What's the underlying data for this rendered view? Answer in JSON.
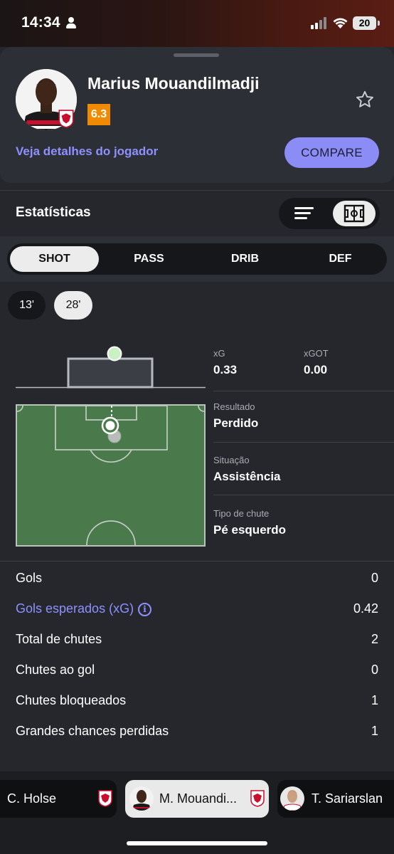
{
  "status_bar": {
    "time": "14:34",
    "battery": "20"
  },
  "player": {
    "name": "Marius Mouandilmadji",
    "rating": "6.3",
    "rating_color": "#f08a00"
  },
  "actions": {
    "details_link": "Veja detalhes do jogador",
    "compare_label": "COMPARE"
  },
  "stats_section": {
    "title": "Estatísticas"
  },
  "tabs": [
    {
      "label": "SHOT",
      "active": true
    },
    {
      "label": "PASS",
      "active": false
    },
    {
      "label": "DRIB",
      "active": false
    },
    {
      "label": "DEF",
      "active": false
    }
  ],
  "shot_chips": [
    {
      "label": "13'",
      "selected": false
    },
    {
      "label": "28'",
      "selected": true
    }
  ],
  "shot_detail": {
    "xg_label": "xG",
    "xg_value": "0.33",
    "xgot_label": "xGOT",
    "xgot_value": "0.00",
    "result_label": "Resultado",
    "result_value": "Perdido",
    "situation_label": "Situação",
    "situation_value": "Assistência",
    "shot_type_label": "Tipo de chute",
    "shot_type_value": "Pé esquerdo"
  },
  "summary": [
    {
      "label": "Gols",
      "value": "0"
    },
    {
      "label": "Gols esperados (xG)",
      "value": "0.42"
    },
    {
      "label": "Total de chutes",
      "value": "2"
    },
    {
      "label": "Chutes ao gol",
      "value": "0"
    },
    {
      "label": "Chutes bloqueados",
      "value": "1"
    },
    {
      "label": "Grandes chances perdidas",
      "value": "1"
    }
  ],
  "player_carousel": [
    {
      "name": "C. Holse",
      "active": false
    },
    {
      "name": "M. Mouandi...",
      "active": true
    },
    {
      "name": "T. Sariarslan",
      "active": false
    }
  ],
  "colors": {
    "accent": "#8f90ff",
    "compare_button": "#8b8cf5",
    "pitch": "#4a7a4c",
    "sheet": "#25272d",
    "card": "#2c2f36"
  }
}
